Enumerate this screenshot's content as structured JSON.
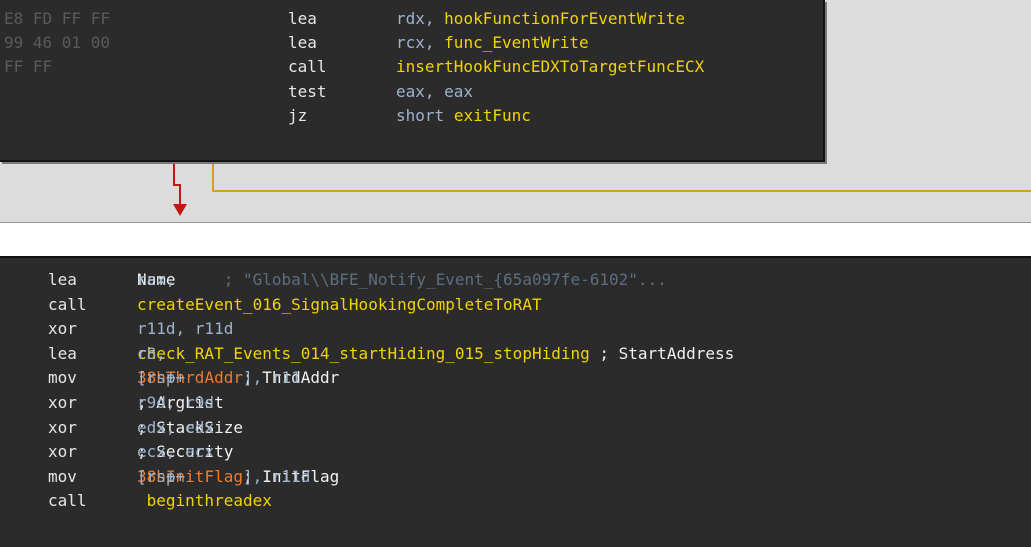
{
  "top_block": [
    {
      "bytes": "E8 FD FF FF",
      "mnemonic": "lea",
      "op1": "rdx,",
      "ref": "hookFunctionForEventWrite"
    },
    {
      "bytes": "99 46 01 00",
      "mnemonic": "lea",
      "op1": "rcx,",
      "ref": "func_EventWrite"
    },
    {
      "bytes": "FF FF",
      "mnemonic": "call",
      "op1": "",
      "ref": "insertHookFuncEDXToTargetFuncECX"
    },
    {
      "bytes": "",
      "mnemonic": "test",
      "op1": "eax, eax",
      "ref": ""
    },
    {
      "bytes": "",
      "mnemonic": "jz",
      "op1": "short",
      "ref": "exitFunc"
    }
  ],
  "bottom_block": [
    {
      "mnemonic": "lea",
      "parts": [
        [
          "ops",
          "rcx, "
        ],
        [
          "cmt",
          "Name"
        ],
        [
          "cm",
          "     ; \"Global\\\\BFE_Notify_Event_{65a097fe-6102\"..."
        ]
      ]
    },
    {
      "mnemonic": "call",
      "parts": [
        [
          "ref",
          "createEvent_016_SignalHookingCompleteToRAT"
        ]
      ]
    },
    {
      "mnemonic": "xor",
      "parts": [
        [
          "ops",
          "r11d, r11d"
        ]
      ]
    },
    {
      "mnemonic": "lea",
      "parts": [
        [
          "ops",
          "r8, "
        ],
        [
          "ref",
          "check_RAT_Events_014_startHiding_015_stopHiding"
        ],
        [
          "cmt",
          " ; StartAddress"
        ]
      ]
    },
    {
      "mnemonic": "mov",
      "parts": [
        [
          "ops",
          "[rsp+"
        ],
        [
          "off",
          "38h"
        ],
        [
          "ops",
          "+"
        ],
        [
          "off",
          "ThrdAddr"
        ],
        [
          "ops",
          "], r11 "
        ],
        [
          "cmt",
          "; ThrdAddr"
        ]
      ]
    },
    {
      "mnemonic": "xor",
      "parts": [
        [
          "ops",
          "r9d, r9d       "
        ],
        [
          "cmt",
          "; ArgList"
        ]
      ]
    },
    {
      "mnemonic": "xor",
      "parts": [
        [
          "ops",
          "edx, edx       "
        ],
        [
          "cmt",
          "; StackSize"
        ]
      ]
    },
    {
      "mnemonic": "xor",
      "parts": [
        [
          "ops",
          "ecx, ecx       "
        ],
        [
          "cmt",
          "; Security"
        ]
      ]
    },
    {
      "mnemonic": "mov",
      "parts": [
        [
          "ops",
          "[rsp+"
        ],
        [
          "off",
          "38h"
        ],
        [
          "ops",
          "+"
        ],
        [
          "off",
          "InitFlag"
        ],
        [
          "ops",
          "], r11d "
        ],
        [
          "cmt",
          "; InitFlag"
        ]
      ]
    },
    {
      "mnemonic": "call",
      "parts": [
        [
          "ref",
          " beginthreadex"
        ]
      ]
    }
  ],
  "colors": {
    "block_bg": "#2b2b2b",
    "graph_bg": "#dcdcdc",
    "mnemonic": "#e6e6e6",
    "operand": "#9fb3cc",
    "name_ref": "#f0d400",
    "offset": "#f07a2a",
    "comment_dim": "#5c6e80",
    "edge_taken": "#c01818",
    "edge_fallthrough": "#d9a01a"
  }
}
